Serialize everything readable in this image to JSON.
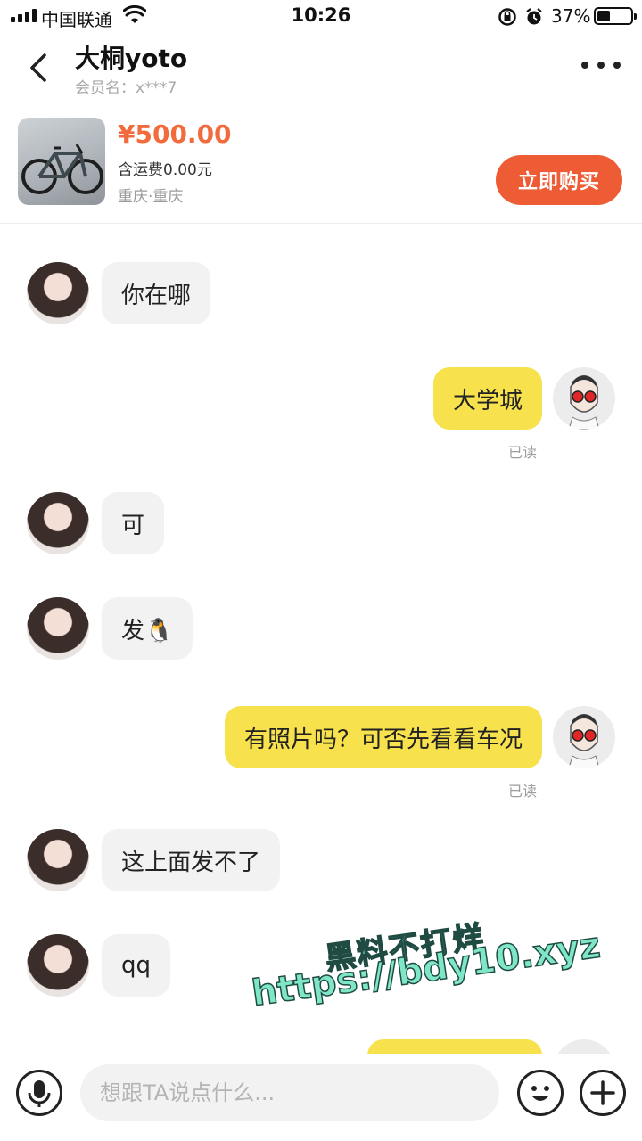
{
  "status_bar": {
    "carrier": "中国联通",
    "time": "10:26",
    "battery_pct": "37%"
  },
  "header": {
    "title": "大桐yoto",
    "member": "会员名：x***7"
  },
  "product": {
    "price": "¥500.00",
    "shipping": "含运费0.00元",
    "location": "重庆·重庆",
    "buy_label": "立即购买"
  },
  "messages": [
    {
      "side": "left",
      "text": "你在哪"
    },
    {
      "side": "right",
      "text": "大学城",
      "status": "已读"
    },
    {
      "side": "left",
      "text": "可"
    },
    {
      "side": "left",
      "text": "发🐧"
    },
    {
      "side": "right",
      "text": "有照片吗？可否先看看车况",
      "status": "已读"
    },
    {
      "side": "left",
      "text": "这上面发不了"
    },
    {
      "side": "left",
      "text": "qq"
    }
  ],
  "watermark": {
    "line1": "黑料不打烊",
    "line2": "https://bdy10.xyz"
  },
  "input": {
    "placeholder": "想跟TA说点什么..."
  },
  "icons": [
    "back-icon",
    "more-icon",
    "mic-icon",
    "emoji-icon",
    "plus-icon",
    "wifi-icon",
    "alarm-icon",
    "lock-rotation-icon"
  ],
  "colors": {
    "accent": "#ee5c35",
    "price": "#f26b3d",
    "my_bubble": "#f7e14c",
    "their_bubble": "#f2f2f2"
  }
}
